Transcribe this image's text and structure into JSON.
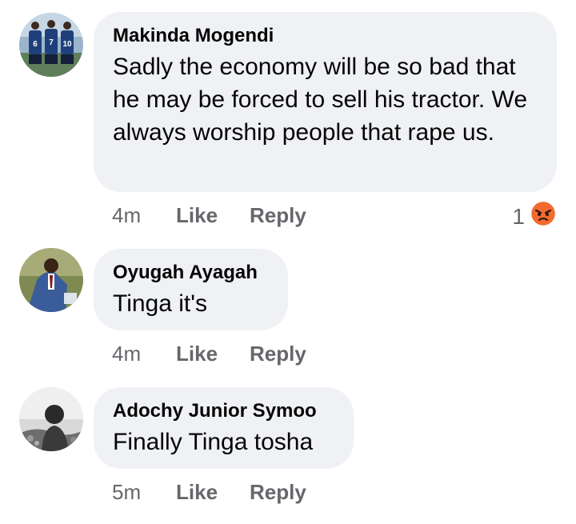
{
  "comments": [
    {
      "author": "Makinda Mogendi",
      "text": "Sadly the economy will be so bad that he may be forced to sell his tractor. We always worship people that rape us.",
      "time": "4m",
      "like_label": "Like",
      "reply_label": "Reply",
      "reaction_count": "1",
      "reaction_icon": "angry-reaction-icon",
      "avatar_jersey_numbers": [
        "6",
        "7",
        "10"
      ]
    },
    {
      "author": "Oyugah Ayagah",
      "text": "Tinga it's",
      "time": "4m",
      "like_label": "Like",
      "reply_label": "Reply"
    },
    {
      "author": "Adochy Junior Symoo",
      "text": "Finally Tinga tosha",
      "time": "5m",
      "like_label": "Like",
      "reply_label": "Reply"
    }
  ],
  "colors": {
    "bubble": "#eff1f4",
    "secondary_text": "#65676b",
    "angry_reaction": "#f26a2e"
  }
}
